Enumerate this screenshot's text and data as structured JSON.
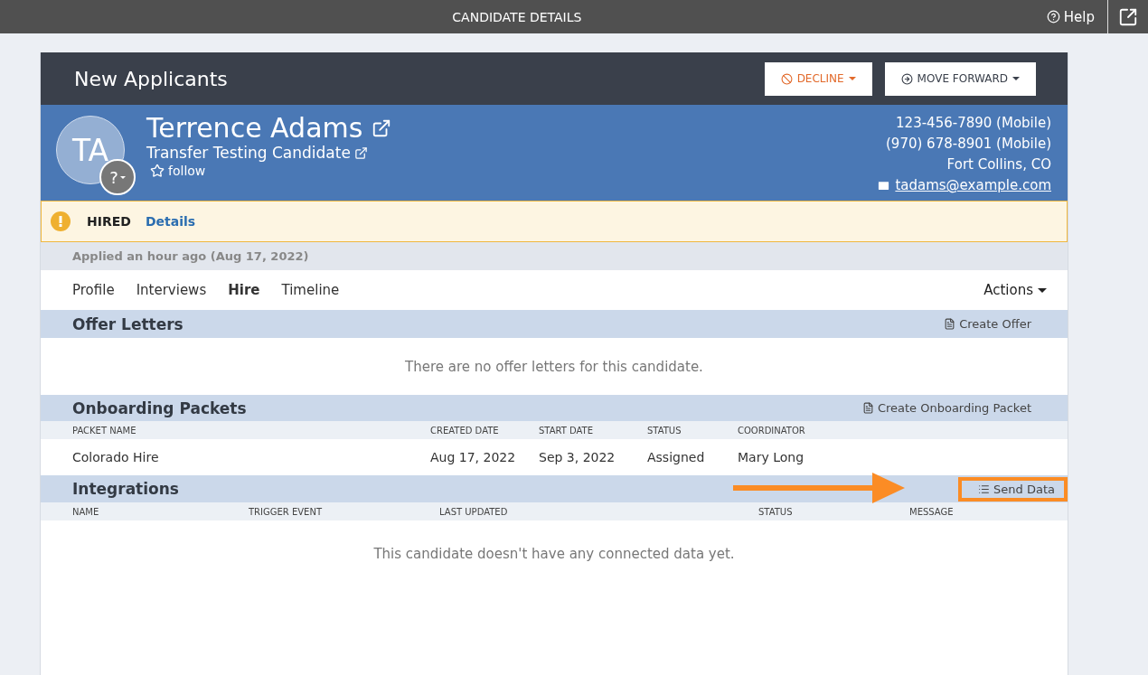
{
  "top_bar": {
    "title": "CANDIDATE DETAILS",
    "help": "Help"
  },
  "header": {
    "title": "New Applicants",
    "buttons": [
      {
        "label": "DECLINE",
        "kind": "decline"
      },
      {
        "label": "MOVE FORWARD",
        "kind": "forward"
      }
    ]
  },
  "candidate": {
    "initials": "TA",
    "badge": "?",
    "name": "Terrence Adams",
    "job": "Transfer Testing Candidate",
    "follow": "follow",
    "contacts": [
      {
        "kind": "text",
        "text": "123-456-7890 (Mobile)"
      },
      {
        "kind": "text",
        "text": "(970) 678-8901 (Mobile)"
      },
      {
        "kind": "text",
        "text": "Fort Collins, CO"
      },
      {
        "kind": "email",
        "text": "tadams@example.com"
      }
    ]
  },
  "alert": {
    "status": "HIRED",
    "link": "Details"
  },
  "applied": "Applied an hour ago (Aug 17, 2022)",
  "tabs": [
    {
      "label": "Profile",
      "selected": false
    },
    {
      "label": "Interviews",
      "selected": false
    },
    {
      "label": "Hire",
      "selected": true
    },
    {
      "label": "Timeline",
      "selected": false
    }
  ],
  "actions": "Actions",
  "offer_letters": {
    "title": "Offer Letters",
    "action": "Create Offer",
    "empty": "There are no offer letters for this candidate."
  },
  "onboarding": {
    "title": "Onboarding Packets",
    "action": "Create Onboarding Packet",
    "columns": [
      "PACKET NAME",
      "CREATED DATE",
      "START DATE",
      "STATUS",
      "COORDINATOR"
    ],
    "rows": [
      [
        "Colorado Hire",
        "Aug 17, 2022",
        "Sep 3, 2022",
        "Assigned",
        "Mary Long"
      ]
    ]
  },
  "integrations": {
    "title": "Integrations",
    "action": "Send Data",
    "highlighted": true,
    "columns": [
      "NAME",
      "TRIGGER EVENT",
      "LAST UPDATED",
      "STATUS",
      "MESSAGE"
    ],
    "empty": "This candidate doesn't have any connected data yet."
  }
}
